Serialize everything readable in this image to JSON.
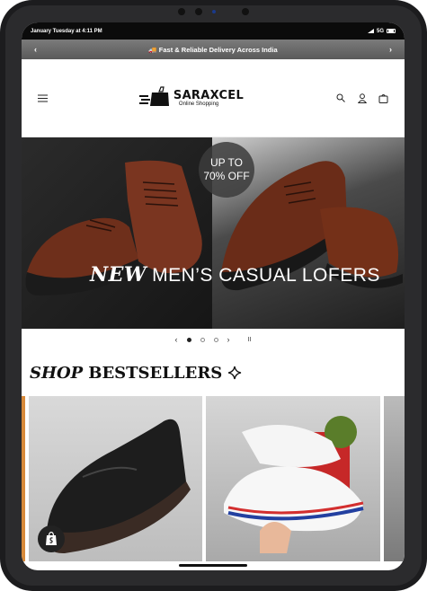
{
  "status": {
    "datetime": "January Tuesday at 4:11 PM",
    "network": "5G"
  },
  "announcement": {
    "text": "🚚 Fast & Reliable Delivery Across India",
    "prev_label": "‹",
    "next_label": "›"
  },
  "header": {
    "logo_name": "SARAXCEL",
    "logo_tagline": "Online Shopping"
  },
  "hero": {
    "badge_line1": "UP TO",
    "badge_line2": "70% OFF",
    "caption_prefix": "NEW",
    "caption": "MEN’S CASUAL LOFERS"
  },
  "slider": {
    "prev_label": "‹",
    "next_label": "›",
    "pause_label": "II",
    "slide_count": 3,
    "active_slide": 1
  },
  "section": {
    "title_italic": "SHOP",
    "title_rest": "BESTSELLERS",
    "title_icon": "sparkle-icon"
  },
  "products": [
    {
      "image_icon": "black-loafer-image"
    },
    {
      "image_icon": "white-sneaker-image"
    }
  ],
  "colors": {
    "accent_dark": "#111111",
    "announcement_bg": "#6b6b6b",
    "status_bg": "#0b0b0b"
  }
}
